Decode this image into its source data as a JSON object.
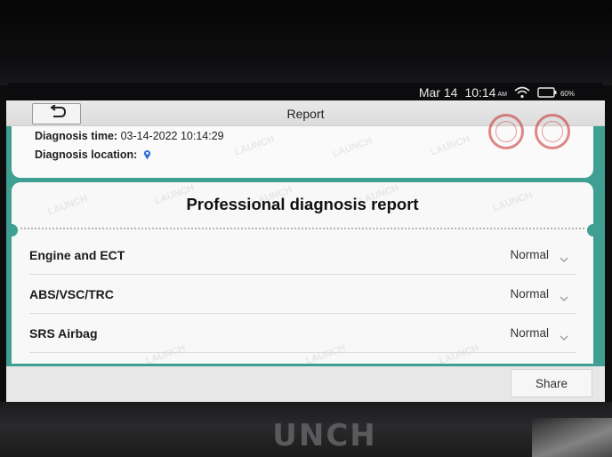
{
  "status_bar": {
    "date": "Mar 14",
    "time": "10:14",
    "ampm": "AM",
    "battery": "60%",
    "icons": [
      "wifi-icon",
      "battery-icon"
    ]
  },
  "header": {
    "title": "Report",
    "back_icon": "back-arrow-icon"
  },
  "info": {
    "diagnosis_time_label": "Diagnosis time:",
    "diagnosis_time_value": "03-14-2022 10:14:29",
    "diagnosis_location_label": "Diagnosis location:",
    "location_icon": "location-pin-icon"
  },
  "report": {
    "heading": "Professional diagnosis report",
    "rows": [
      {
        "label": "Engine and ECT",
        "status": "Normal"
      },
      {
        "label": "ABS/VSC/TRC",
        "status": "Normal"
      },
      {
        "label": "SRS Airbag",
        "status": "Normal"
      }
    ]
  },
  "footer": {
    "share_label": "Share"
  },
  "device": {
    "brand": "UNCH"
  },
  "colors": {
    "accent_teal": "#3e9f92",
    "stamp_red": "#c82828"
  }
}
